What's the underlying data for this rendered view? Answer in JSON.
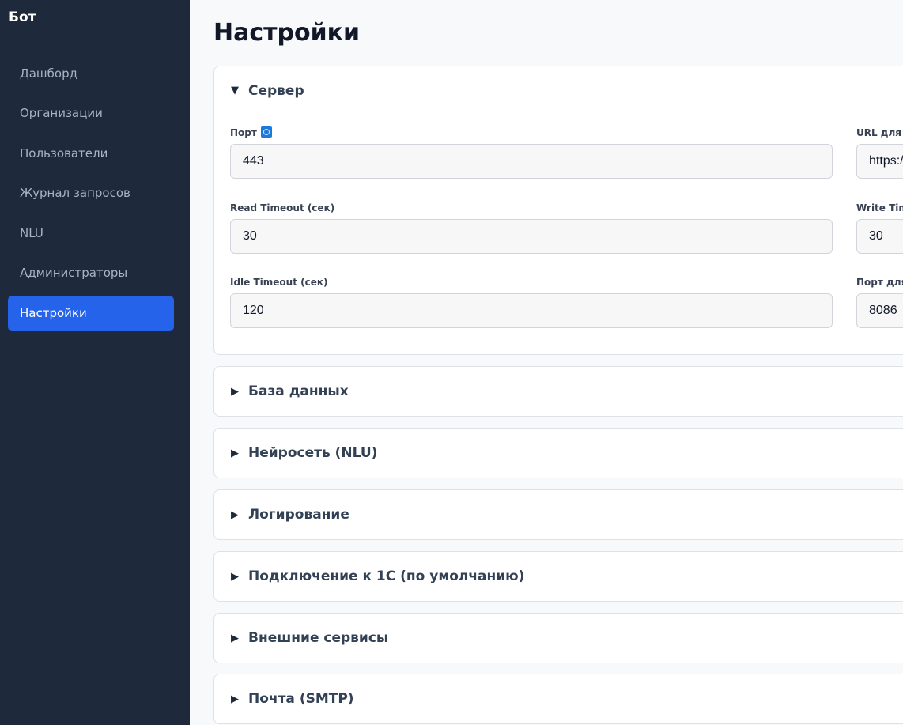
{
  "sidebar": {
    "brand": "Бот",
    "items": [
      {
        "label": "Дашборд"
      },
      {
        "label": "Организации"
      },
      {
        "label": "Пользователи"
      },
      {
        "label": "Журнал запросов"
      },
      {
        "label": "NLU"
      },
      {
        "label": "Администраторы"
      },
      {
        "label": "Настройки",
        "active": true
      }
    ]
  },
  "main": {
    "title": "Настройки",
    "sections": [
      {
        "title": "Сервер",
        "expanded": true,
        "fields": [
          {
            "label": "Порт",
            "value": "443",
            "icon": "info-icon"
          },
          {
            "label": "URL для о",
            "value": "https:/"
          },
          {
            "label": "Read Timeout (сек)",
            "value": "30"
          },
          {
            "label": "Write Time",
            "value": "30"
          },
          {
            "label": "Idle Timeout (сек)",
            "value": "120"
          },
          {
            "label": "Порт для",
            "value": "8086"
          }
        ]
      },
      {
        "title": "База данных",
        "expanded": false
      },
      {
        "title": "Нейросеть (NLU)",
        "expanded": false
      },
      {
        "title": "Логирование",
        "expanded": false
      },
      {
        "title": "Подключение к 1С (по умолчанию)",
        "expanded": false
      },
      {
        "title": "Внешние сервисы",
        "expanded": false
      },
      {
        "title": "Почта (SMTP)",
        "expanded": false
      }
    ]
  },
  "icons": {
    "expanded": "▼",
    "collapsed": "▶"
  },
  "colors": {
    "sidebar_bg": "#1e293b",
    "active_item": "#2563eb",
    "page_bg": "#f8f9fb"
  }
}
